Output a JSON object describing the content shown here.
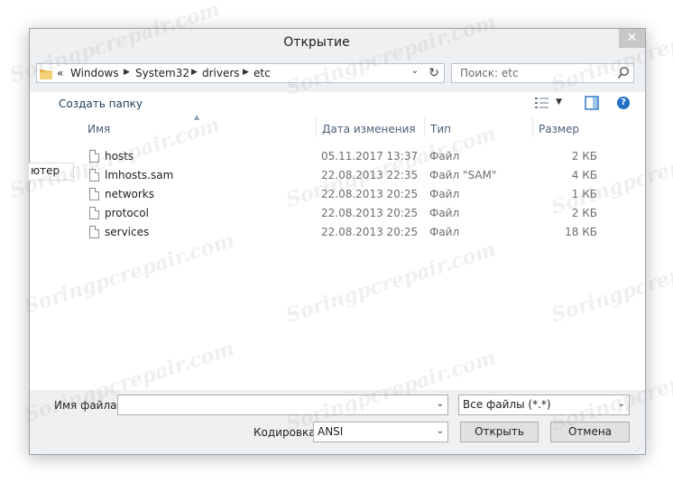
{
  "dialog": {
    "title": "Открытие"
  },
  "address_bar": {
    "overflow": "«",
    "crumbs": [
      "Windows",
      "System32",
      "drivers",
      "etc"
    ]
  },
  "search": {
    "placeholder": "Поиск: etc"
  },
  "toolbar": {
    "new_folder": "Создать папку"
  },
  "nav_pane": {
    "item": "ютер"
  },
  "columns": {
    "name": "Имя",
    "date": "Дата изменения",
    "type": "Тип",
    "size": "Размер"
  },
  "files": [
    {
      "name": "hosts",
      "date": "05.11.2017 13:37",
      "type": "Файл",
      "size": "2 КБ"
    },
    {
      "name": "lmhosts.sam",
      "date": "22.08.2013 22:35",
      "type": "Файл \"SAM\"",
      "size": "4 КБ"
    },
    {
      "name": "networks",
      "date": "22.08.2013 20:25",
      "type": "Файл",
      "size": "1 КБ"
    },
    {
      "name": "protocol",
      "date": "22.08.2013 20:25",
      "type": "Файл",
      "size": "2 КБ"
    },
    {
      "name": "services",
      "date": "22.08.2013 20:25",
      "type": "Файл",
      "size": "18 КБ"
    }
  ],
  "bottom": {
    "filename_label": "Имя файла:",
    "filename_value": "",
    "filetype_value": "Все файлы  (*.*)",
    "encoding_label": "Кодировка:",
    "encoding_value": "ANSI",
    "open_button": "Открыть",
    "cancel_button": "Отмена"
  },
  "watermark": "Soringpcrepair.com",
  "colors": {
    "accent": "#1f6fc5",
    "chrome": "#eef0f2",
    "header_text": "#4c607a"
  }
}
